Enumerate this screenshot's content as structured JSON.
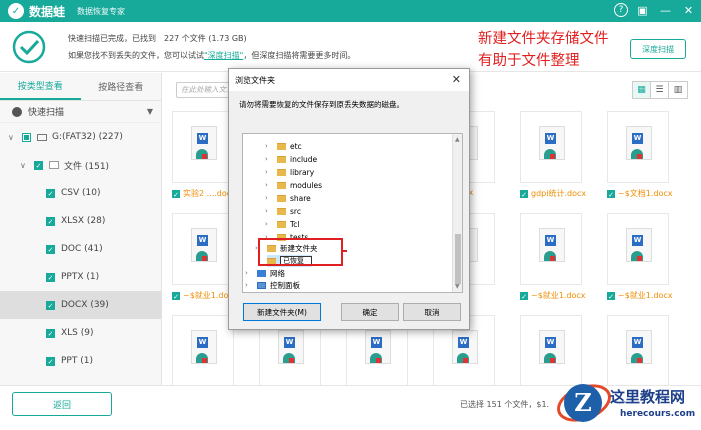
{
  "app": {
    "name": "数据蛙",
    "subtitle": "数据恢复专家",
    "help_glyph": "?",
    "save_glyph": "▣",
    "min_glyph": "—",
    "close_glyph": "✕"
  },
  "status": {
    "line1": "快速扫描已完成，已找到　227 个文件 (1.73 GB)",
    "line2_pre": "如果您找不到丢失的文件，您可以试试",
    "line2_link": "\"深度扫描\"",
    "line2_post": "，但深度扫描将需要更多时间。",
    "deep_scan_btn": "深度扫描"
  },
  "annotation": {
    "line1": "新建文件夹存储文件",
    "line2": "有助于文件整理"
  },
  "sidebar": {
    "tabs": [
      "按类型查看",
      "按路径查看"
    ],
    "quick_scan": "快速扫描",
    "drive": "G:(FAT32) (227)",
    "files": "文件 (151)",
    "items": [
      "CSV (10)",
      "XLSX (28)",
      "DOC (41)",
      "PPTX (1)",
      "DOCX (39)",
      "XLS (9)",
      "PPT (1)"
    ]
  },
  "toolbar": {
    "search_placeholder": "在此处输入文..."
  },
  "files": {
    "labels": [
      "实验2 ....docx",
      "",
      "",
      "....docx",
      "gdpi统计.docx",
      "~$文档1.docx",
      "~$就业1.docx",
      "~$就业1.docx",
      "~$就业1.docx",
      "~$就业1.docx"
    ]
  },
  "dialog": {
    "title": "浏览文件夹",
    "close": "✕",
    "desc": "请勿将需要恢复的文件保存到原丢失数据的磁盘。",
    "folders": [
      "etc",
      "include",
      "library",
      "modules",
      "share",
      "src",
      "Tcl",
      "tests"
    ],
    "new_folder_label": "新建文件夹",
    "rename_value": "已恢复",
    "network": "网络",
    "control_panel": "控制面板",
    "btn_new_folder": "新建文件夹(M)",
    "btn_ok": "确定",
    "btn_cancel": "取消"
  },
  "footer": {
    "back": "返回",
    "selected": "已选择  151 个文件，$1."
  },
  "watermark": {
    "logo_letter": "Z",
    "title": "这里教程网",
    "url": "herecours.com"
  },
  "colors": {
    "accent": "#17a99a",
    "annotation": "#e02020"
  }
}
